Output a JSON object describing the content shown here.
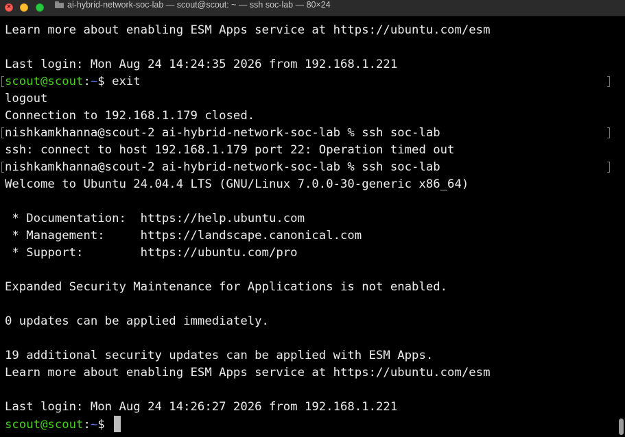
{
  "window": {
    "title": "ai-hybrid-network-soc-lab — scout@scout: ~ — ssh soc-lab — 80×24",
    "title_icon": "folder-icon",
    "traffic_light_close_glyph": "×"
  },
  "colors": {
    "background": "#000000",
    "text": "#ececec",
    "prompt_user": "#47d01c",
    "prompt_path": "#6a7bff"
  },
  "terminal": {
    "lines": [
      "Learn more about enabling ESM Apps service at https://ubuntu.com/esm",
      "",
      "Last login: Mon Aug 24 14:24:35 2026 from 192.168.1.221",
      {
        "user": "scout@scout",
        "sep": ":",
        "path": "~",
        "symbol": "$",
        "command": " exit"
      },
      "logout",
      "Connection to 192.168.1.179 closed.",
      "nishkamkhanna@scout-2 ai-hybrid-network-soc-lab % ssh soc-lab",
      "ssh: connect to host 192.168.1.179 port 22: Operation timed out",
      "nishkamkhanna@scout-2 ai-hybrid-network-soc-lab % ssh soc-lab",
      "Welcome to Ubuntu 24.04.4 LTS (GNU/Linux 7.0.0-30-generic x86_64)",
      "",
      " * Documentation:  https://help.ubuntu.com",
      " * Management:     https://landscape.canonical.com",
      " * Support:        https://ubuntu.com/pro",
      "",
      "Expanded Security Maintenance for Applications is not enabled.",
      "",
      "0 updates can be applied immediately.",
      "",
      "19 additional security updates can be applied with ESM Apps.",
      "Learn more about enabling ESM Apps service at https://ubuntu.com/esm",
      "",
      "Last login: Mon Aug 24 14:26:27 2026 from 192.168.1.221",
      {
        "user": "scout@scout",
        "sep": ":",
        "path": "~",
        "symbol": "$",
        "command": " "
      }
    ]
  }
}
